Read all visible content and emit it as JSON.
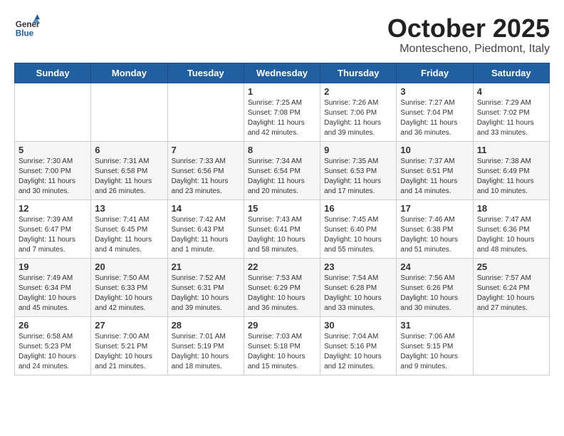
{
  "header": {
    "logo_general": "General",
    "logo_blue": "Blue",
    "month_title": "October 2025",
    "subtitle": "Montescheno, Piedmont, Italy"
  },
  "days_of_week": [
    "Sunday",
    "Monday",
    "Tuesday",
    "Wednesday",
    "Thursday",
    "Friday",
    "Saturday"
  ],
  "weeks": [
    [
      {
        "day": "",
        "info": ""
      },
      {
        "day": "",
        "info": ""
      },
      {
        "day": "",
        "info": ""
      },
      {
        "day": "1",
        "info": "Sunrise: 7:25 AM\nSunset: 7:08 PM\nDaylight: 11 hours\nand 42 minutes."
      },
      {
        "day": "2",
        "info": "Sunrise: 7:26 AM\nSunset: 7:06 PM\nDaylight: 11 hours\nand 39 minutes."
      },
      {
        "day": "3",
        "info": "Sunrise: 7:27 AM\nSunset: 7:04 PM\nDaylight: 11 hours\nand 36 minutes."
      },
      {
        "day": "4",
        "info": "Sunrise: 7:29 AM\nSunset: 7:02 PM\nDaylight: 11 hours\nand 33 minutes."
      }
    ],
    [
      {
        "day": "5",
        "info": "Sunrise: 7:30 AM\nSunset: 7:00 PM\nDaylight: 11 hours\nand 30 minutes."
      },
      {
        "day": "6",
        "info": "Sunrise: 7:31 AM\nSunset: 6:58 PM\nDaylight: 11 hours\nand 26 minutes."
      },
      {
        "day": "7",
        "info": "Sunrise: 7:33 AM\nSunset: 6:56 PM\nDaylight: 11 hours\nand 23 minutes."
      },
      {
        "day": "8",
        "info": "Sunrise: 7:34 AM\nSunset: 6:54 PM\nDaylight: 11 hours\nand 20 minutes."
      },
      {
        "day": "9",
        "info": "Sunrise: 7:35 AM\nSunset: 6:53 PM\nDaylight: 11 hours\nand 17 minutes."
      },
      {
        "day": "10",
        "info": "Sunrise: 7:37 AM\nSunset: 6:51 PM\nDaylight: 11 hours\nand 14 minutes."
      },
      {
        "day": "11",
        "info": "Sunrise: 7:38 AM\nSunset: 6:49 PM\nDaylight: 11 hours\nand 10 minutes."
      }
    ],
    [
      {
        "day": "12",
        "info": "Sunrise: 7:39 AM\nSunset: 6:47 PM\nDaylight: 11 hours\nand 7 minutes."
      },
      {
        "day": "13",
        "info": "Sunrise: 7:41 AM\nSunset: 6:45 PM\nDaylight: 11 hours\nand 4 minutes."
      },
      {
        "day": "14",
        "info": "Sunrise: 7:42 AM\nSunset: 6:43 PM\nDaylight: 11 hours\nand 1 minute."
      },
      {
        "day": "15",
        "info": "Sunrise: 7:43 AM\nSunset: 6:41 PM\nDaylight: 10 hours\nand 58 minutes."
      },
      {
        "day": "16",
        "info": "Sunrise: 7:45 AM\nSunset: 6:40 PM\nDaylight: 10 hours\nand 55 minutes."
      },
      {
        "day": "17",
        "info": "Sunrise: 7:46 AM\nSunset: 6:38 PM\nDaylight: 10 hours\nand 51 minutes."
      },
      {
        "day": "18",
        "info": "Sunrise: 7:47 AM\nSunset: 6:36 PM\nDaylight: 10 hours\nand 48 minutes."
      }
    ],
    [
      {
        "day": "19",
        "info": "Sunrise: 7:49 AM\nSunset: 6:34 PM\nDaylight: 10 hours\nand 45 minutes."
      },
      {
        "day": "20",
        "info": "Sunrise: 7:50 AM\nSunset: 6:33 PM\nDaylight: 10 hours\nand 42 minutes."
      },
      {
        "day": "21",
        "info": "Sunrise: 7:52 AM\nSunset: 6:31 PM\nDaylight: 10 hours\nand 39 minutes."
      },
      {
        "day": "22",
        "info": "Sunrise: 7:53 AM\nSunset: 6:29 PM\nDaylight: 10 hours\nand 36 minutes."
      },
      {
        "day": "23",
        "info": "Sunrise: 7:54 AM\nSunset: 6:28 PM\nDaylight: 10 hours\nand 33 minutes."
      },
      {
        "day": "24",
        "info": "Sunrise: 7:56 AM\nSunset: 6:26 PM\nDaylight: 10 hours\nand 30 minutes."
      },
      {
        "day": "25",
        "info": "Sunrise: 7:57 AM\nSunset: 6:24 PM\nDaylight: 10 hours\nand 27 minutes."
      }
    ],
    [
      {
        "day": "26",
        "info": "Sunrise: 6:58 AM\nSunset: 5:23 PM\nDaylight: 10 hours\nand 24 minutes."
      },
      {
        "day": "27",
        "info": "Sunrise: 7:00 AM\nSunset: 5:21 PM\nDaylight: 10 hours\nand 21 minutes."
      },
      {
        "day": "28",
        "info": "Sunrise: 7:01 AM\nSunset: 5:19 PM\nDaylight: 10 hours\nand 18 minutes."
      },
      {
        "day": "29",
        "info": "Sunrise: 7:03 AM\nSunset: 5:18 PM\nDaylight: 10 hours\nand 15 minutes."
      },
      {
        "day": "30",
        "info": "Sunrise: 7:04 AM\nSunset: 5:16 PM\nDaylight: 10 hours\nand 12 minutes."
      },
      {
        "day": "31",
        "info": "Sunrise: 7:06 AM\nSunset: 5:15 PM\nDaylight: 10 hours\nand 9 minutes."
      },
      {
        "day": "",
        "info": ""
      }
    ]
  ]
}
